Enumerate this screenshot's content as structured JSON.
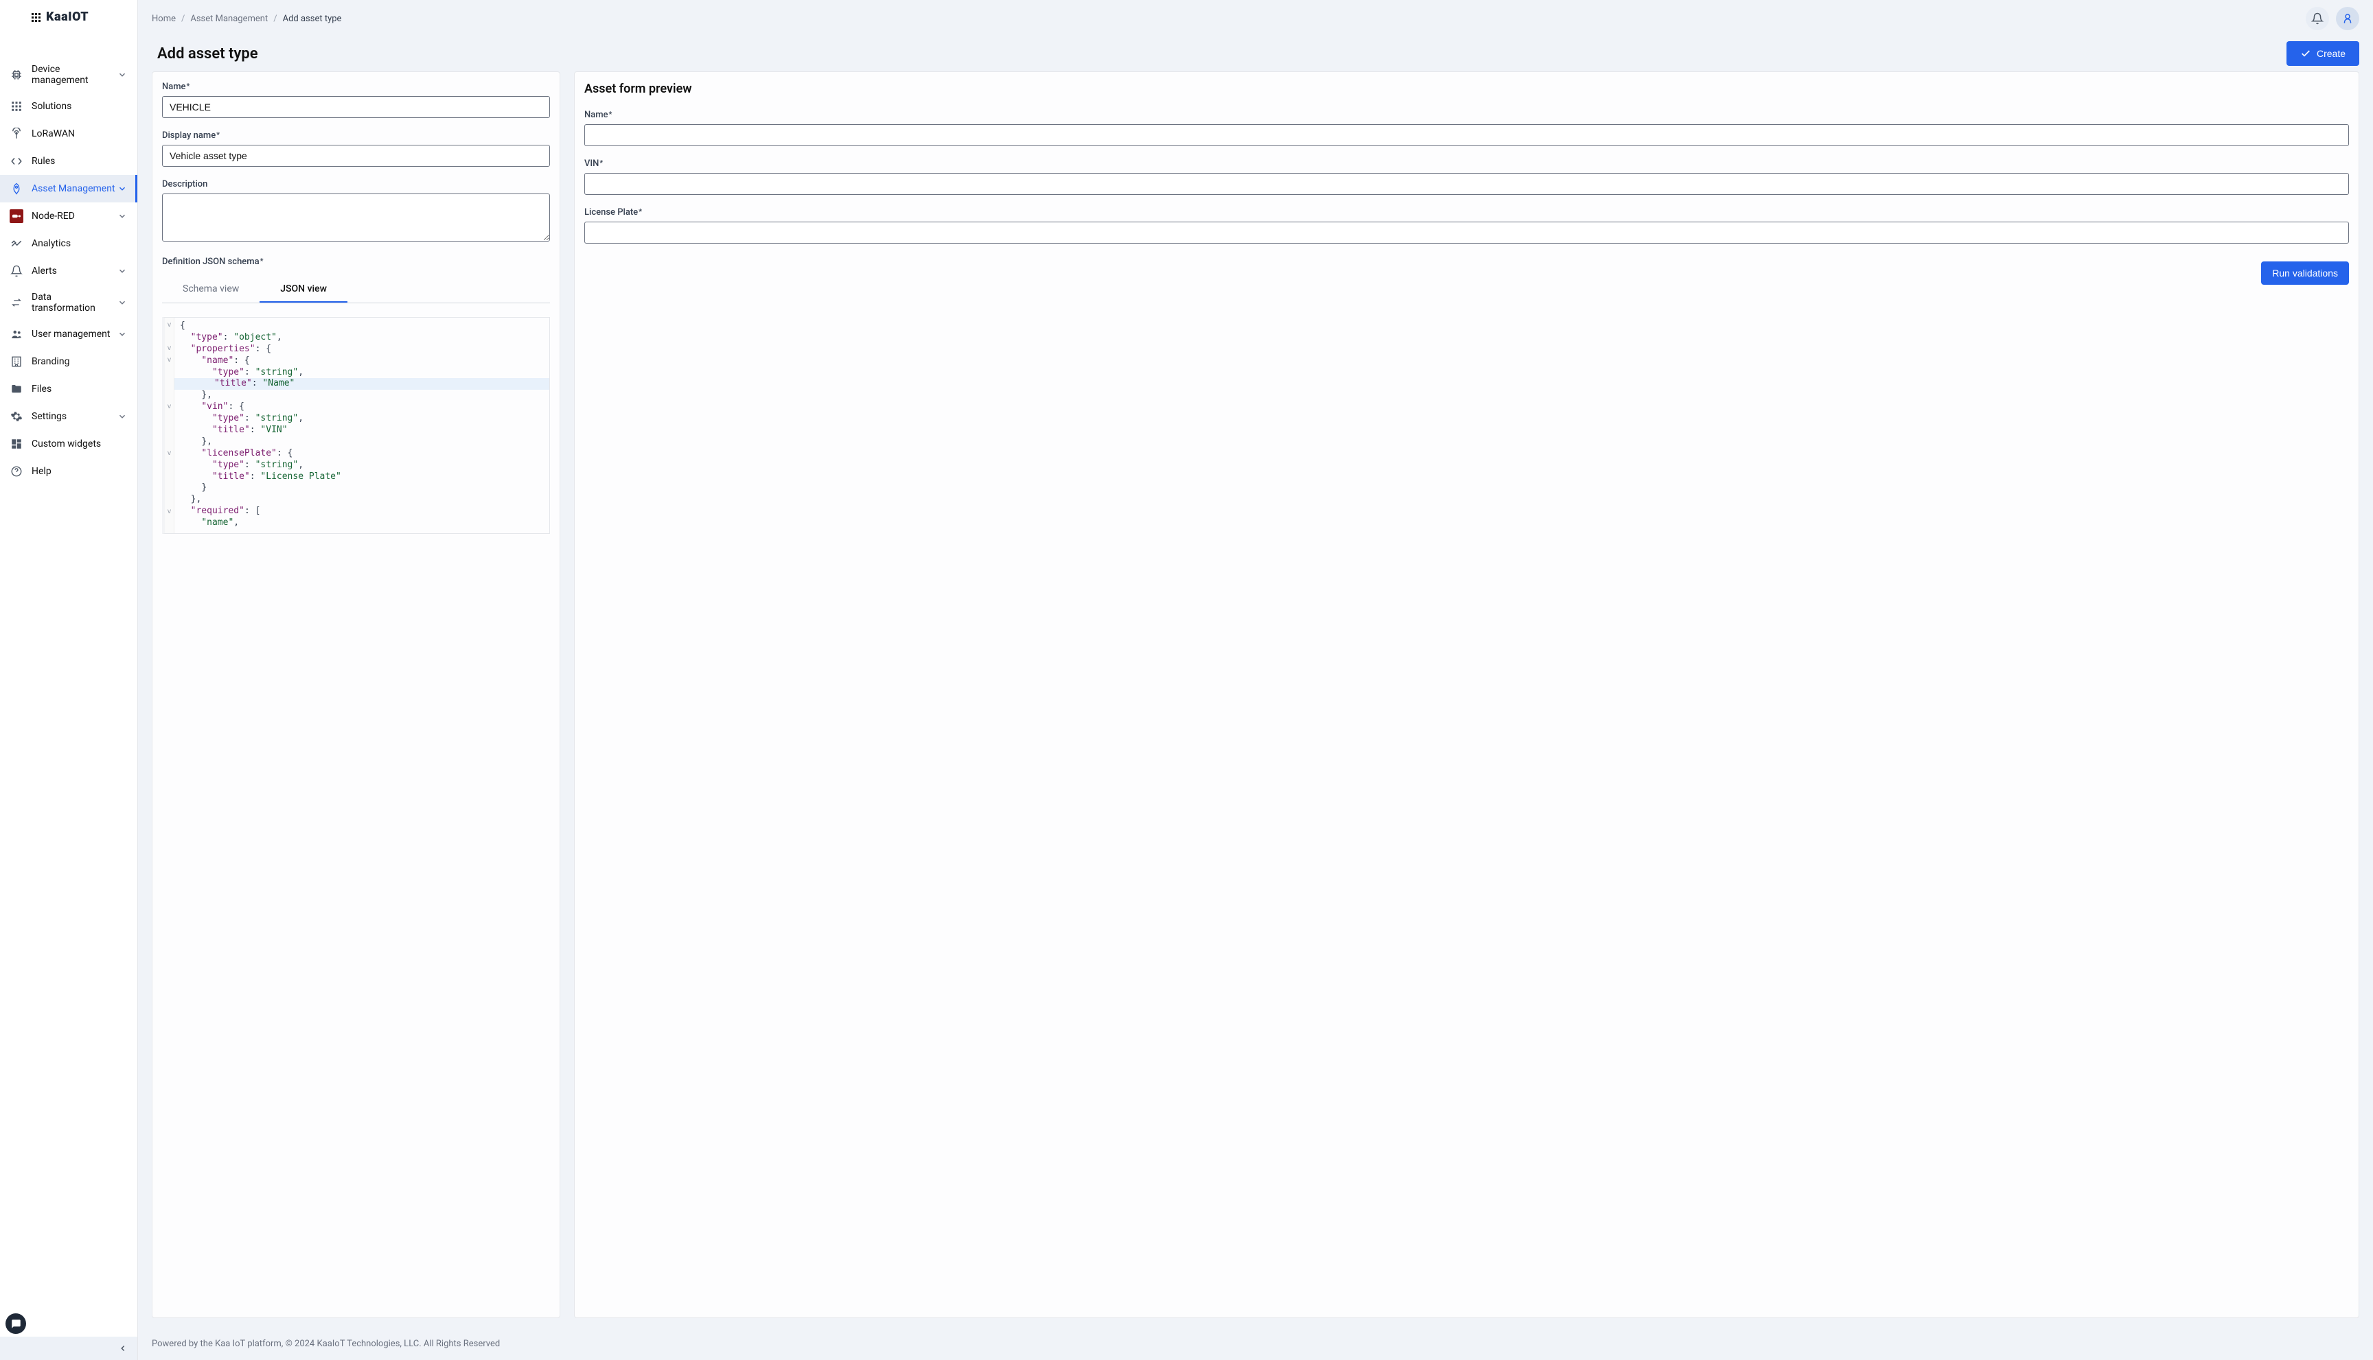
{
  "logo": {
    "text": "KaaIOT"
  },
  "sidebar": {
    "items": [
      {
        "label": "Device management",
        "icon": "chip",
        "expandable": true
      },
      {
        "label": "Solutions",
        "icon": "apps",
        "expandable": false
      },
      {
        "label": "LoRaWAN",
        "icon": "antenna",
        "expandable": false
      },
      {
        "label": "Rules",
        "icon": "code-brackets",
        "expandable": false
      },
      {
        "label": "Asset Management",
        "icon": "rocket",
        "expandable": true,
        "active": true
      },
      {
        "label": "Node-RED",
        "icon": "nodered",
        "expandable": true
      },
      {
        "label": "Analytics",
        "icon": "trend",
        "expandable": false
      },
      {
        "label": "Alerts",
        "icon": "bell",
        "expandable": true
      },
      {
        "label": "Data transformation",
        "icon": "exchange",
        "expandable": true
      },
      {
        "label": "User management",
        "icon": "users",
        "expandable": true
      },
      {
        "label": "Branding",
        "icon": "office",
        "expandable": false
      },
      {
        "label": "Files",
        "icon": "folder",
        "expandable": false
      },
      {
        "label": "Settings",
        "icon": "gear",
        "expandable": true
      },
      {
        "label": "Custom widgets",
        "icon": "dashboard",
        "expandable": false
      },
      {
        "label": "Help",
        "icon": "help",
        "expandable": false
      }
    ]
  },
  "breadcrumb": {
    "home": "Home",
    "parent": "Asset Management",
    "current": "Add asset type"
  },
  "page": {
    "title": "Add asset type",
    "create_label": "Create"
  },
  "form": {
    "name_label": "Name",
    "name_value": "VEHICLE",
    "display_name_label": "Display name",
    "display_name_value": "Vehicle asset type",
    "description_label": "Description",
    "description_value": "",
    "schema_label": "Definition JSON schema",
    "tabs": {
      "schema": "Schema view",
      "json": "JSON view"
    }
  },
  "schema_code": {
    "lines": [
      {
        "fold": "v",
        "html": "<span class='tok-pun'>{</span>"
      },
      {
        "fold": "",
        "html": "  <span class='tok-key'>\"type\"</span><span class='tok-pun'>: </span><span class='tok-str'>\"object\"</span><span class='tok-pun'>,</span>"
      },
      {
        "fold": "v",
        "html": "  <span class='tok-key'>\"properties\"</span><span class='tok-pun'>: {</span>"
      },
      {
        "fold": "v",
        "html": "    <span class='tok-key'>\"name\"</span><span class='tok-pun'>: {</span>"
      },
      {
        "fold": "",
        "html": "      <span class='tok-key'>\"type\"</span><span class='tok-pun'>: </span><span class='tok-str'>\"string\"</span><span class='tok-pun'>,</span>"
      },
      {
        "fold": "",
        "hl": true,
        "html": "      <span class='tok-key'>\"title\"</span><span class='tok-pun'>: </span><span class='tok-str'>\"Name\"</span>"
      },
      {
        "fold": "",
        "html": "    <span class='tok-pun'>},</span>"
      },
      {
        "fold": "v",
        "html": "    <span class='tok-key'>\"vin\"</span><span class='tok-pun'>: {</span>"
      },
      {
        "fold": "",
        "html": "      <span class='tok-key'>\"type\"</span><span class='tok-pun'>: </span><span class='tok-str'>\"string\"</span><span class='tok-pun'>,</span>"
      },
      {
        "fold": "",
        "html": "      <span class='tok-key'>\"title\"</span><span class='tok-pun'>: </span><span class='tok-str'>\"VIN\"</span>"
      },
      {
        "fold": "",
        "html": "    <span class='tok-pun'>},</span>"
      },
      {
        "fold": "v",
        "html": "    <span class='tok-key'>\"licensePlate\"</span><span class='tok-pun'>: {</span>"
      },
      {
        "fold": "",
        "html": "      <span class='tok-key'>\"type\"</span><span class='tok-pun'>: </span><span class='tok-str'>\"string\"</span><span class='tok-pun'>,</span>"
      },
      {
        "fold": "",
        "html": "      <span class='tok-key'>\"title\"</span><span class='tok-pun'>: </span><span class='tok-str'>\"License Plate\"</span>"
      },
      {
        "fold": "",
        "html": "    <span class='tok-pun'>}</span>"
      },
      {
        "fold": "",
        "html": "  <span class='tok-pun'>},</span>"
      },
      {
        "fold": "v",
        "html": "  <span class='tok-key'>\"required\"</span><span class='tok-pun'>: [</span>"
      },
      {
        "fold": "",
        "html": "    <span class='tok-str'>\"name\"</span><span class='tok-pun'>,</span>"
      }
    ]
  },
  "preview": {
    "title": "Asset form preview",
    "fields": [
      {
        "label": "Name"
      },
      {
        "label": "VIN"
      },
      {
        "label": "License Plate"
      }
    ],
    "run_label": "Run validations"
  },
  "footer": {
    "text": "Powered by the Kaa IoT platform, © 2024 KaaIoT Technologies, LLC. All Rights Reserved"
  }
}
